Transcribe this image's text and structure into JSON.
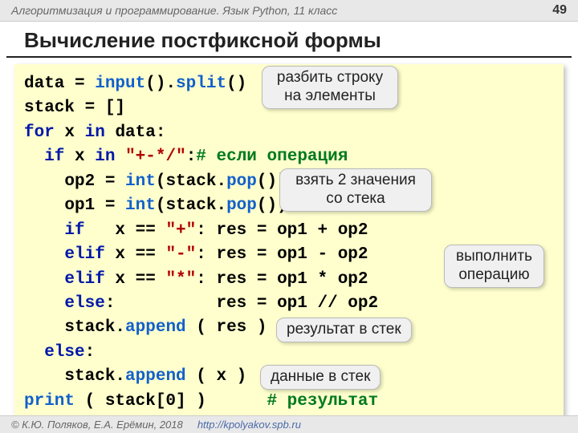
{
  "header": {
    "course": "Алгоритмизация и программирование. Язык Python, 11 класс",
    "page": "49"
  },
  "title": "Вычисление постфиксной формы",
  "code": {
    "l1a": "data = ",
    "l1b": "input",
    "l1c": "().",
    "l1d": "split",
    "l1e": "()",
    "l2": "stack = []",
    "l3a": "for",
    "l3b": " x ",
    "l3c": "in",
    "l3d": " data:",
    "l4a": "  if",
    "l4b": " x ",
    "l4c": "in",
    "l4d": " ",
    "l4e": "\"+-*/\"",
    "l4f": ":",
    "l4g": "# если операция",
    "l5a": "    op2 = ",
    "l5b": "int",
    "l5c": "(stack.",
    "l5d": "pop",
    "l5e": "())",
    "l6a": "    op1 = ",
    "l6b": "int",
    "l6c": "(stack.",
    "l6d": "pop",
    "l6e": "())",
    "l7a": "    if",
    "l7b": "   x == ",
    "l7c": "\"+\"",
    "l7d": ": res = op1 + op2",
    "l8a": "    elif",
    "l8b": " x == ",
    "l8c": "\"-\"",
    "l8d": ": res = op1 - op2",
    "l9a": "    elif",
    "l9b": " x == ",
    "l9c": "\"*\"",
    "l9d": ": res = op1 * op2",
    "l10a": "    else",
    "l10b": ":          res = op1 // op2",
    "l11a": "    stack.",
    "l11b": "append",
    "l11c": " ( res )",
    "l12a": "  else",
    "l12b": ":",
    "l13a": "    stack.",
    "l13b": "append",
    "l13c": " ( x )",
    "l14a": "print",
    "l14b": " ( stack[0] )      ",
    "l14c": "# результат"
  },
  "callouts": {
    "c1": "разбить строку\nна элементы",
    "c2": "взять 2 значения\nсо стека",
    "c3": "выполнить\nоперацию",
    "c4": "результат в стек",
    "c5": "данные в стек"
  },
  "footer": {
    "copyright": "© К.Ю. Поляков, Е.А. Ерёмин, 2018",
    "url": "http://kpolyakov.spb.ru"
  }
}
